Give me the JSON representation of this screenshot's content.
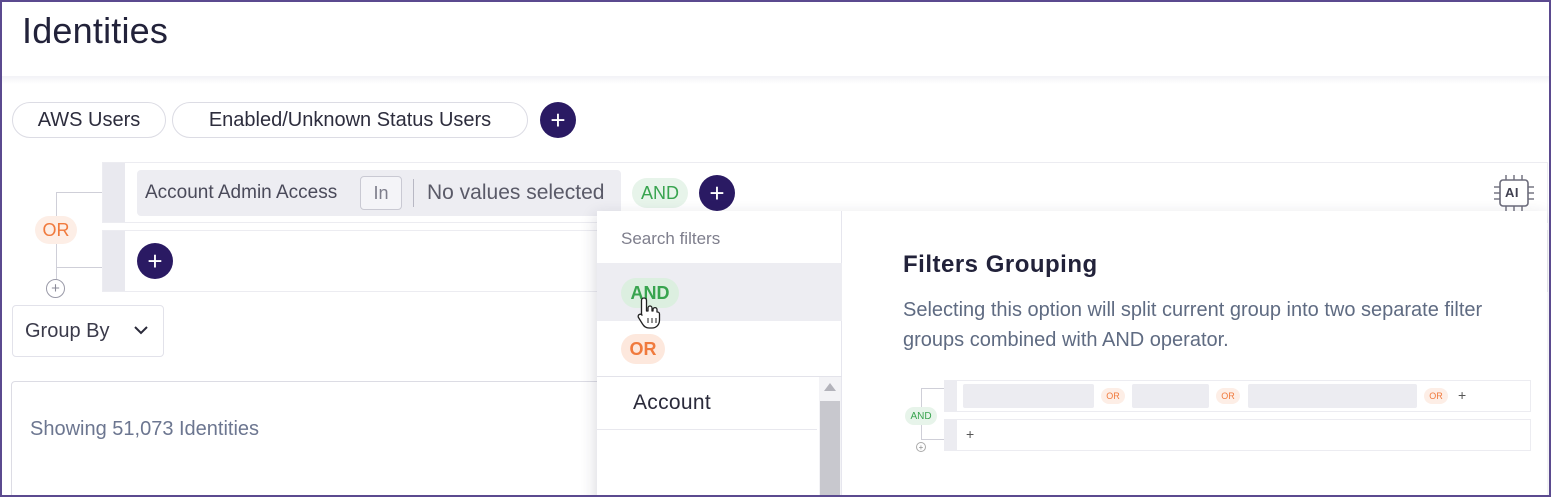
{
  "page": {
    "title": "Identities"
  },
  "saved_filters": [
    {
      "label": "AWS Users"
    },
    {
      "label": "Enabled/Unknown Status Users"
    }
  ],
  "filter_group": {
    "operator_between_groups": "OR",
    "condition": {
      "field": "Account Admin Access",
      "operator": "In",
      "value": "No values selected",
      "join": "AND"
    }
  },
  "ai_button": {
    "label": "AI"
  },
  "group_by": {
    "label": "Group By"
  },
  "results": {
    "summary": "Showing 51,073 Identities"
  },
  "dropdown": {
    "search_placeholder": "Search filters",
    "options": [
      "AND",
      "OR"
    ],
    "fields": [
      "Account"
    ],
    "help": {
      "title": "Filters Grouping",
      "description": "Selecting this option will split current group into two separate filter groups combined with AND operator.",
      "illustration": {
        "group_operator": "AND",
        "inner_operator": "OR"
      }
    }
  },
  "colors": {
    "primary": "#2a1a63",
    "and_green": "#38a44f",
    "or_orange": "#f07a3d",
    "frame_border": "#5b4a8f"
  }
}
